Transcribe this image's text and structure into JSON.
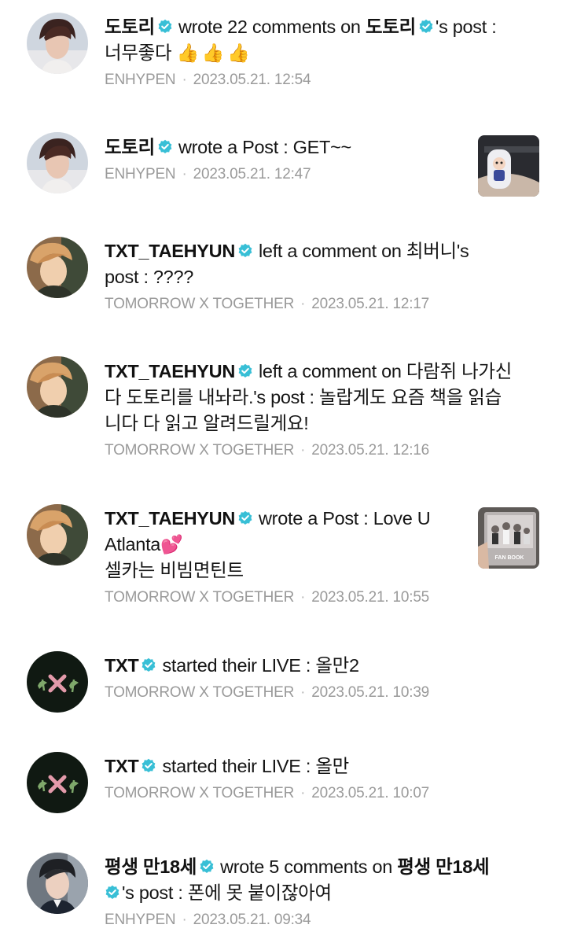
{
  "colors": {
    "verified_badge": "#38bfd6",
    "meta_text": "#9a9a9a",
    "name_text": "#111111"
  },
  "icons": {
    "verified": "verified-check-icon",
    "thumbs_up": "👍",
    "hearts": "💕"
  },
  "items": [
    {
      "name": "도토리",
      "action": "wrote 22 comments on",
      "target_name": "도토리",
      "suffix": "'s post :",
      "text": "너무좋다",
      "group": "ENHYPEN",
      "time": "2023.05.21. 12:54"
    },
    {
      "name": "도토리",
      "action": "wrote a Post : GET~~",
      "group": "ENHYPEN",
      "time": "2023.05.21. 12:47"
    },
    {
      "name": "TXT_TAEHYUN",
      "action": "left a comment on 최버니's",
      "action2": "post : ????",
      "group": "TOMORROW X TOGETHER",
      "time": "2023.05.21. 12:17"
    },
    {
      "name": "TXT_TAEHYUN",
      "action": "left a comment on 다람쥐 나가신",
      "action2": "다 도토리를 내놔라.'s post : 놀랍게도 요즘 책을 읽습",
      "action3": "니다 다 읽고 알려드릴게요!",
      "group": "TOMORROW X TOGETHER",
      "time": "2023.05.21. 12:16"
    },
    {
      "name": "TXT_TAEHYUN",
      "action": "wrote a Post : Love U",
      "action2": "Atlanta",
      "action3": "셀카는 비빔면틴트",
      "group": "TOMORROW X TOGETHER",
      "time": "2023.05.21. 10:55",
      "thumb_caption": "FAN BOOK"
    },
    {
      "name": "TXT",
      "action": "started their LIVE : 올만2",
      "group": "TOMORROW X TOGETHER",
      "time": "2023.05.21. 10:39"
    },
    {
      "name": "TXT",
      "action": "started their LIVE : 올만",
      "group": "TOMORROW X TOGETHER",
      "time": "2023.05.21. 10:07"
    },
    {
      "name": "평생 만18세",
      "action": "wrote 5 comments on",
      "target_name": "평생 만18세",
      "suffix": "'s post : 폰에 못 붙이잖아여",
      "group": "ENHYPEN",
      "time": "2023.05.21. 09:34"
    }
  ]
}
